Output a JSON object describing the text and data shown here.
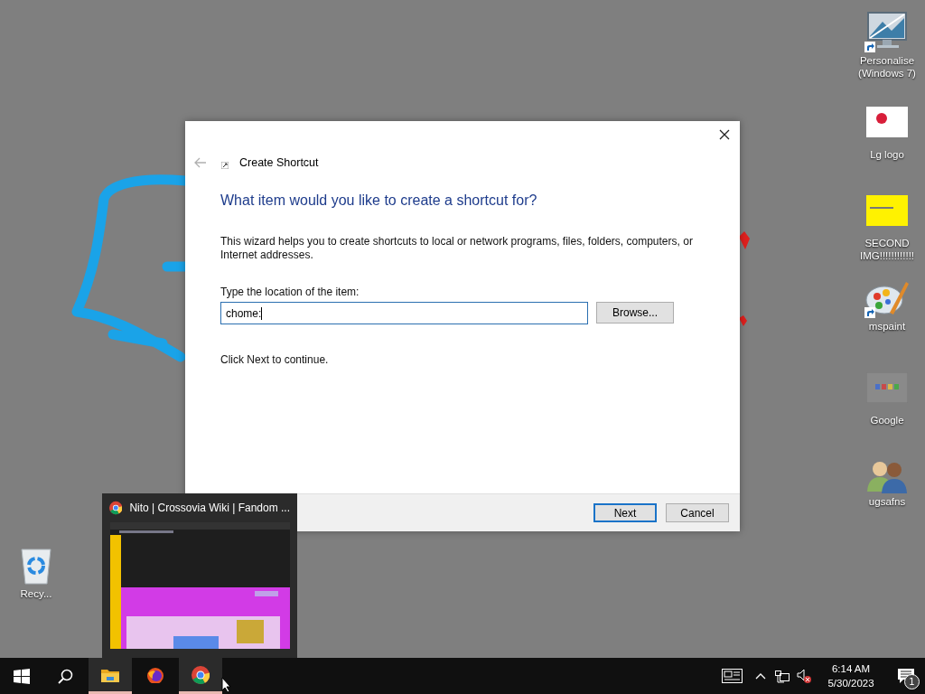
{
  "desktop": {
    "icons": [
      {
        "label": "Personalise (Windows 7)",
        "kind": "monitor",
        "shortcut": true
      },
      {
        "label": "Lg logo",
        "kind": "white-image",
        "shortcut": false
      },
      {
        "label": "SECOND IMG!!!!!!!!!!!!",
        "kind": "yellow-image",
        "shortcut": false
      },
      {
        "label": "mspaint",
        "kind": "palette",
        "shortcut": true
      },
      {
        "label": "Google",
        "kind": "grey-image",
        "shortcut": false
      },
      {
        "label": "ugsafns",
        "kind": "users",
        "shortcut": false
      },
      {
        "label": "Recy...",
        "kind": "recycle",
        "shortcut": false
      }
    ]
  },
  "dialog": {
    "title": "Create Shortcut",
    "heading": "What item would you like to create a shortcut for?",
    "description": "This wizard helps you to create shortcuts to local or network programs, files, folders, computers, or Internet addresses.",
    "field_label": "Type the location of the item:",
    "field": {
      "value": "chome:"
    },
    "browse_button": "Browse...",
    "hint": "Click Next to continue.",
    "buttons": [
      {
        "label": "Next",
        "default": true
      },
      {
        "label": "Cancel",
        "default": false
      }
    ]
  },
  "preview": {
    "title": "Nito | Crossovia Wiki | Fandom ..."
  },
  "taskbar": {
    "apps": [
      {
        "kind": "explorer",
        "running": true
      },
      {
        "kind": "firefox",
        "running": false
      },
      {
        "kind": "chrome",
        "running": true
      }
    ],
    "time": "6:14 AM",
    "date": "5/30/2023",
    "notifications": "1"
  }
}
